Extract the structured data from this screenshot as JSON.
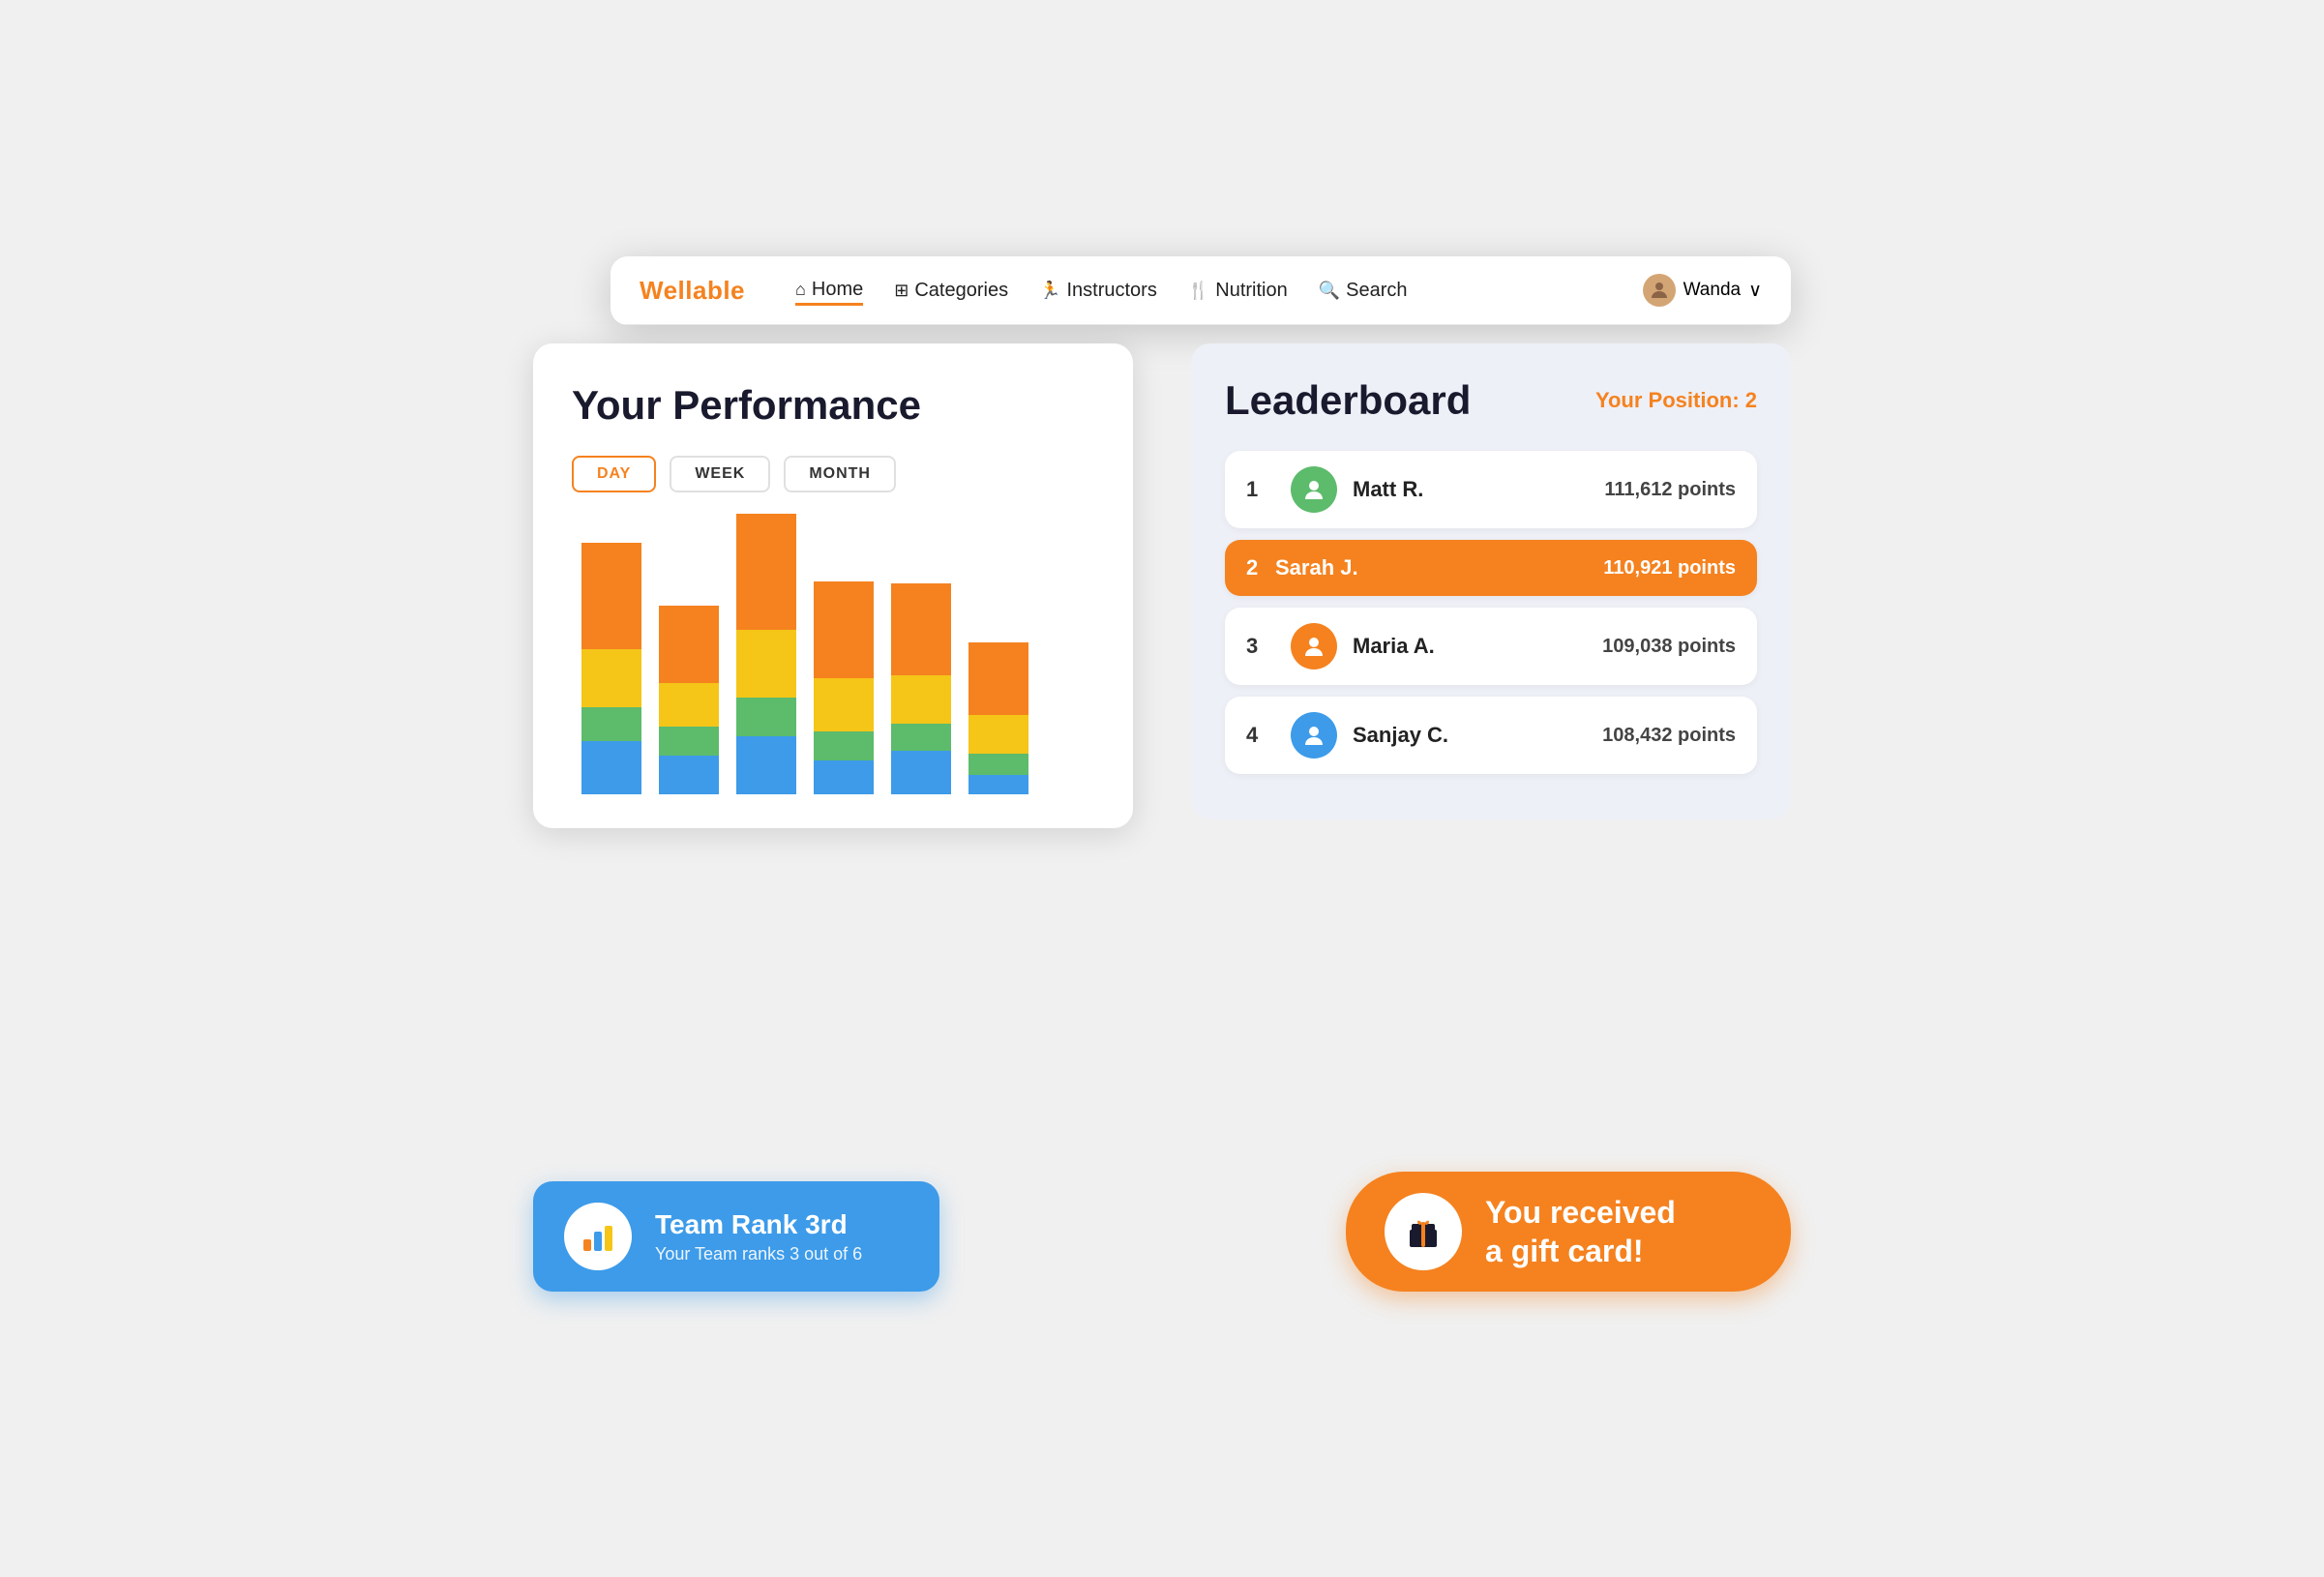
{
  "brand": "Wellable",
  "nav": {
    "items": [
      {
        "id": "home",
        "label": "Home",
        "icon": "⌂",
        "active": true
      },
      {
        "id": "categories",
        "label": "Categories",
        "icon": "⊞",
        "active": false
      },
      {
        "id": "instructors",
        "label": "Instructors",
        "icon": "🏃",
        "active": false
      },
      {
        "id": "nutrition",
        "label": "Nutrition",
        "icon": "🍴",
        "active": false
      },
      {
        "id": "search",
        "label": "Search",
        "icon": "🔍",
        "active": false
      }
    ],
    "user": {
      "name": "Wanda",
      "chevron": "∨"
    }
  },
  "performance": {
    "title": "Your Performance",
    "filters": [
      {
        "label": "DAY",
        "active": true
      },
      {
        "label": "WEEK",
        "active": false
      },
      {
        "label": "MONTH",
        "active": false
      }
    ],
    "chart": {
      "bars": [
        {
          "segments": [
            {
              "color": "#f5821f",
              "height": 110
            },
            {
              "color": "#f5c518",
              "height": 60
            },
            {
              "color": "#5dbb6c",
              "height": 35
            },
            {
              "color": "#3d9be9",
              "height": 55
            }
          ]
        },
        {
          "segments": [
            {
              "color": "#f5821f",
              "height": 80
            },
            {
              "color": "#f5c518",
              "height": 45
            },
            {
              "color": "#5dbb6c",
              "height": 30
            },
            {
              "color": "#3d9be9",
              "height": 40
            }
          ]
        },
        {
          "segments": [
            {
              "color": "#f5821f",
              "height": 120
            },
            {
              "color": "#f5c518",
              "height": 70
            },
            {
              "color": "#5dbb6c",
              "height": 40
            },
            {
              "color": "#3d9be9",
              "height": 60
            }
          ]
        },
        {
          "segments": [
            {
              "color": "#f5821f",
              "height": 100
            },
            {
              "color": "#f5c518",
              "height": 55
            },
            {
              "color": "#5dbb6c",
              "height": 30
            },
            {
              "color": "#3d9be9",
              "height": 35
            }
          ]
        },
        {
          "segments": [
            {
              "color": "#f5821f",
              "height": 95
            },
            {
              "color": "#f5c518",
              "height": 50
            },
            {
              "color": "#5dbb6c",
              "height": 28
            },
            {
              "color": "#3d9be9",
              "height": 45
            }
          ]
        },
        {
          "segments": [
            {
              "color": "#f5821f",
              "height": 75
            },
            {
              "color": "#f5c518",
              "height": 40
            },
            {
              "color": "#5dbb6c",
              "height": 22
            },
            {
              "color": "#3d9be9",
              "height": 20
            }
          ]
        }
      ]
    }
  },
  "leaderboard": {
    "title": "Leaderboard",
    "position_label": "Your Position: 2",
    "entries": [
      {
        "rank": "1",
        "name": "Matt R.",
        "points": "111,612 points",
        "avatar_color": "green",
        "highlighted": false
      },
      {
        "rank": "2",
        "name": "Sarah J.",
        "points": "110,921 points",
        "avatar_color": "",
        "highlighted": true
      },
      {
        "rank": "3",
        "name": "Maria A.",
        "points": "109,038 points",
        "avatar_color": "orange",
        "highlighted": false
      },
      {
        "rank": "4",
        "name": "Sanjay C.",
        "points": "108,432 points",
        "avatar_color": "blue",
        "highlighted": false
      }
    ]
  },
  "team_rank_banner": {
    "title": "Team Rank 3rd",
    "subtitle": "Your Team ranks 3 out of 6",
    "icon": "📊"
  },
  "gift_banner": {
    "text_line1": "You received",
    "text_line2": "a gift card!",
    "icon": "🎁"
  }
}
